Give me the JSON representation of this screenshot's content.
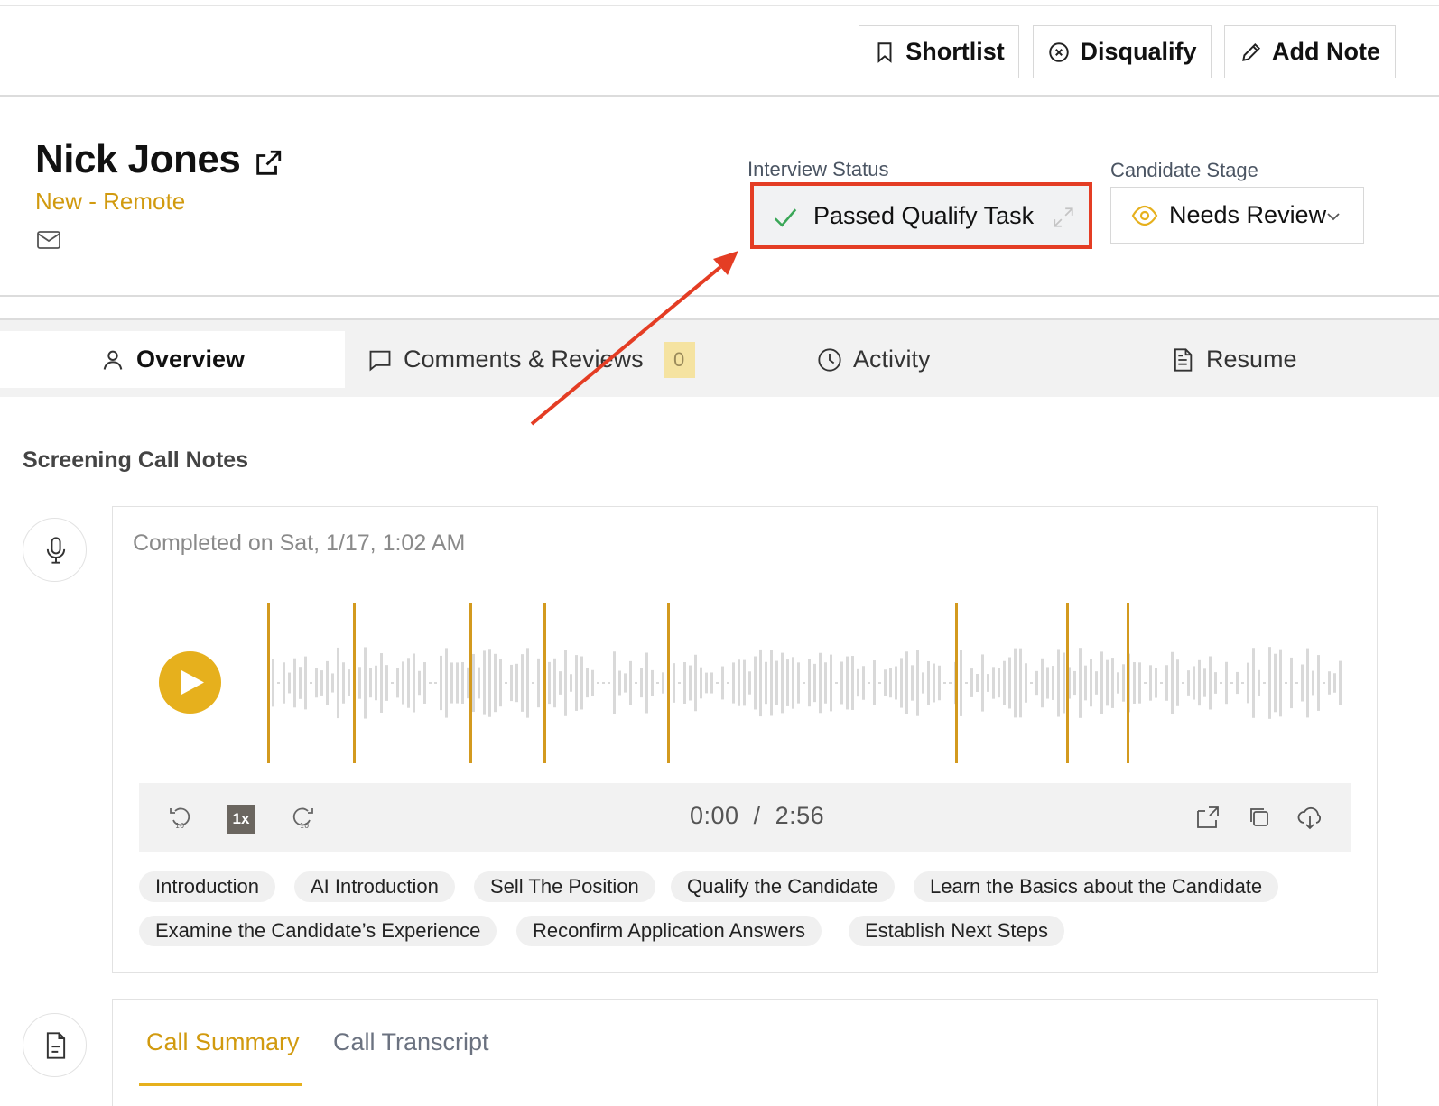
{
  "toolbar": {
    "shortlist_label": "Shortlist",
    "disqualify_label": "Disqualify",
    "add_note_label": "Add Note"
  },
  "candidate": {
    "name": "Nick Jones",
    "subtitle": "New - Remote"
  },
  "interview_status": {
    "label": "Interview Status",
    "value": "Passed Qualify Task"
  },
  "candidate_stage": {
    "label": "Candidate Stage",
    "value": "Needs Review"
  },
  "tabs": {
    "overview": "Overview",
    "comments": "Comments & Reviews",
    "comments_count": "0",
    "activity": "Activity",
    "resume": "Resume"
  },
  "screening": {
    "title": "Screening Call Notes",
    "completed": "Completed on Sat, 1/17, 1:02 AM",
    "speed": "1x",
    "current_time": "0:00",
    "separator": "/",
    "duration": "2:56",
    "chips": [
      "Introduction",
      "AI Introduction",
      "Sell The Position",
      "Qualify the Candidate",
      "Learn the Basics about the Candidate",
      "Examine the Candidate’s Experience",
      "Reconfirm Application Answers",
      "Establish Next Steps"
    ]
  },
  "call_tabs": {
    "summary": "Call Summary",
    "transcript": "Call Transcript"
  },
  "colors": {
    "accent": "#e6b01d",
    "accent_text": "#d19a0f",
    "annotation": "#e43d24",
    "success": "#3aa757"
  }
}
